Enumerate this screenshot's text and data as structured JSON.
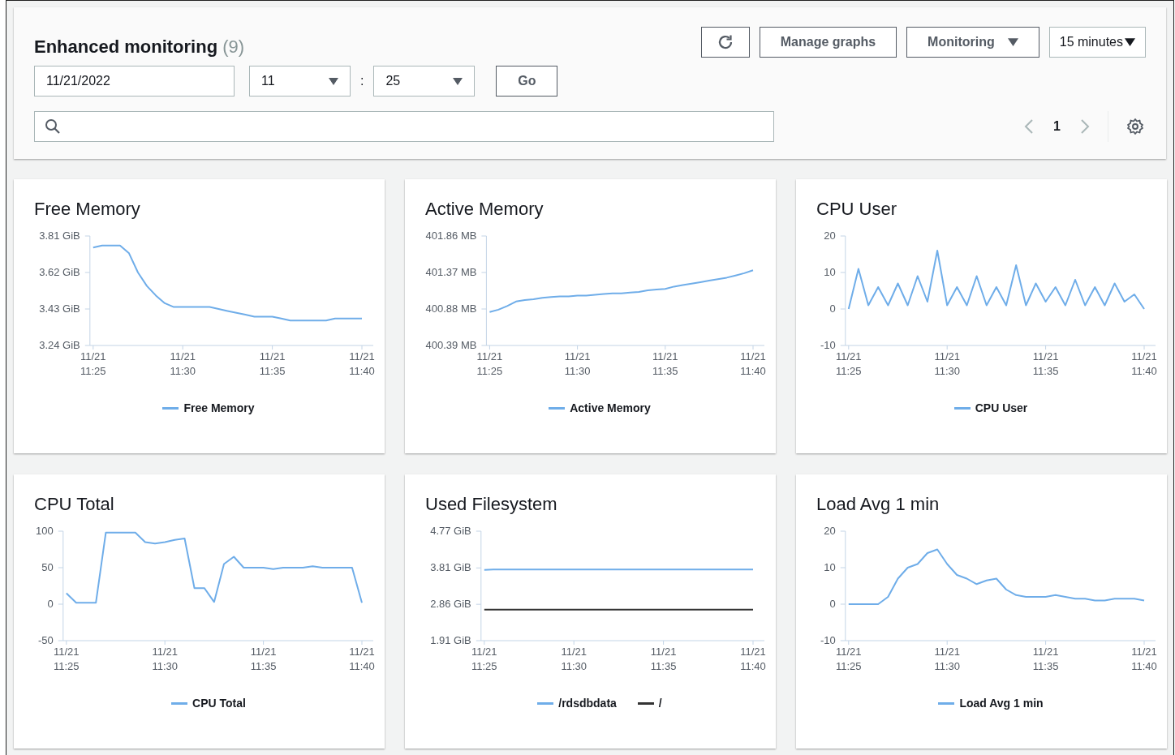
{
  "header": {
    "title": "Enhanced monitoring",
    "count": "(9)",
    "date": "11/21/2022",
    "hour": "11",
    "separator": ":",
    "minute": "25",
    "go_button": "Go",
    "manage_button": "Manage graphs",
    "monitoring_button": "Monitoring",
    "period": "15 minutes",
    "page": "1"
  },
  "graphs": [
    {
      "title": "Free Memory",
      "chart_data": {
        "type": "line",
        "legend": "bottom",
        "ylim": [
          3.24,
          3.81
        ],
        "yticks": [
          {
            "value": 3.24,
            "label": "3.24 GiB"
          },
          {
            "value": 3.43,
            "label": "3.43 GiB"
          },
          {
            "value": 3.62,
            "label": "3.62 GiB"
          },
          {
            "value": 3.81,
            "label": "3.81 GiB"
          }
        ],
        "categories": [
          "11/21 11:25",
          null,
          null,
          null,
          null,
          null,
          null,
          null,
          null,
          null,
          "11/21 11:30",
          null,
          null,
          null,
          null,
          null,
          null,
          null,
          null,
          null,
          "11/21 11:35",
          null,
          null,
          null,
          null,
          null,
          null,
          null,
          null,
          null,
          "11/21 11:40"
        ],
        "series": [
          {
            "name": "Free Memory",
            "color": "#6fade9",
            "values": [
              3.75,
              3.76,
              3.76,
              3.76,
              3.72,
              3.62,
              3.55,
              3.5,
              3.46,
              3.44,
              3.44,
              3.44,
              3.44,
              3.44,
              3.43,
              3.42,
              3.41,
              3.4,
              3.39,
              3.39,
              3.39,
              3.38,
              3.37,
              3.37,
              3.37,
              3.37,
              3.37,
              3.38,
              3.38,
              3.38,
              3.38
            ]
          }
        ]
      }
    },
    {
      "title": "Active Memory",
      "chart_data": {
        "type": "line",
        "legend": "bottom",
        "ylim": [
          400.39,
          401.86
        ],
        "yticks": [
          {
            "value": 400.39,
            "label": "400.39 MB"
          },
          {
            "value": 400.88,
            "label": "400.88 MB"
          },
          {
            "value": 401.37,
            "label": "401.37 MB"
          },
          {
            "value": 401.86,
            "label": "401.86 MB"
          }
        ],
        "categories": [
          "11/21 11:25",
          null,
          null,
          null,
          null,
          null,
          null,
          null,
          null,
          null,
          "11/21 11:30",
          null,
          null,
          null,
          null,
          null,
          null,
          null,
          null,
          null,
          "11/21 11:35",
          null,
          null,
          null,
          null,
          null,
          null,
          null,
          null,
          null,
          "11/21 11:40"
        ],
        "series": [
          {
            "name": "Active Memory",
            "color": "#6fade9",
            "values": [
              400.84,
              400.87,
              400.92,
              400.98,
              401.0,
              401.01,
              401.03,
              401.04,
              401.05,
              401.05,
              401.06,
              401.06,
              401.07,
              401.08,
              401.09,
              401.09,
              401.1,
              401.11,
              401.13,
              401.14,
              401.15,
              401.18,
              401.2,
              401.22,
              401.24,
              401.26,
              401.28,
              401.3,
              401.33,
              401.36,
              401.4
            ]
          }
        ]
      }
    },
    {
      "title": "CPU User",
      "chart_data": {
        "type": "line",
        "legend": "bottom",
        "ylim": [
          -10,
          20
        ],
        "yticks": [
          {
            "value": -10,
            "label": "-10"
          },
          {
            "value": 0,
            "label": "0"
          },
          {
            "value": 10,
            "label": "10"
          },
          {
            "value": 20,
            "label": "20"
          }
        ],
        "categories": [
          "11/21 11:25",
          null,
          null,
          null,
          null,
          null,
          null,
          null,
          null,
          null,
          "11/21 11:30",
          null,
          null,
          null,
          null,
          null,
          null,
          null,
          null,
          null,
          "11/21 11:35",
          null,
          null,
          null,
          null,
          null,
          null,
          null,
          null,
          null,
          "11/21 11:40"
        ],
        "series": [
          {
            "name": "CPU User",
            "color": "#6fade9",
            "values": [
              0,
              11,
              1,
              6,
              1,
              7,
              1,
              9,
              2,
              16,
              1,
              6,
              1,
              9,
              1,
              6,
              1,
              12,
              1,
              7,
              2,
              6,
              1,
              8,
              1,
              6,
              1,
              7,
              2,
              4,
              0
            ]
          }
        ]
      }
    },
    {
      "title": "CPU Total",
      "chart_data": {
        "type": "line",
        "legend": "bottom",
        "ylim": [
          -50,
          100
        ],
        "yticks": [
          {
            "value": -50,
            "label": "-50"
          },
          {
            "value": 0,
            "label": "0"
          },
          {
            "value": 50,
            "label": "50"
          },
          {
            "value": 100,
            "label": "100"
          }
        ],
        "categories": [
          "11/21 11:25",
          null,
          null,
          null,
          null,
          null,
          null,
          null,
          null,
          null,
          "11/21 11:30",
          null,
          null,
          null,
          null,
          null,
          null,
          null,
          null,
          null,
          "11/21 11:35",
          null,
          null,
          null,
          null,
          null,
          null,
          null,
          null,
          null,
          "11/21 11:40"
        ],
        "series": [
          {
            "name": "CPU Total",
            "color": "#6fade9",
            "values": [
              15,
              2,
              2,
              2,
              98,
              98,
              98,
              98,
              85,
              83,
              85,
              88,
              90,
              22,
              22,
              3,
              55,
              65,
              50,
              50,
              50,
              48,
              50,
              50,
              50,
              52,
              50,
              50,
              50,
              50,
              2
            ]
          }
        ]
      }
    },
    {
      "title": "Used Filesystem",
      "chart_data": {
        "type": "line",
        "legend": "bottom",
        "ylim": [
          1.91,
          4.77
        ],
        "yticks": [
          {
            "value": 1.91,
            "label": "1.91 GiB"
          },
          {
            "value": 2.86,
            "label": "2.86 GiB"
          },
          {
            "value": 3.81,
            "label": "3.81 GiB"
          },
          {
            "value": 4.77,
            "label": "4.77 GiB"
          }
        ],
        "categories": [
          "11/21 11:25",
          null,
          null,
          null,
          null,
          null,
          null,
          null,
          null,
          null,
          "11/21 11:30",
          null,
          null,
          null,
          null,
          null,
          null,
          null,
          null,
          null,
          "11/21 11:35",
          null,
          null,
          null,
          null,
          null,
          null,
          null,
          null,
          null,
          "11/21 11:40"
        ],
        "series": [
          {
            "name": "/rdsdbdata",
            "color": "#6fade9",
            "values": [
              3.76,
              3.77,
              3.77,
              3.77,
              3.77,
              3.77,
              3.77,
              3.77,
              3.77,
              3.77,
              3.77,
              3.77,
              3.77,
              3.77,
              3.77,
              3.77,
              3.77,
              3.77,
              3.77,
              3.77,
              3.77,
              3.77,
              3.77,
              3.77,
              3.77,
              3.77,
              3.77,
              3.77,
              3.77,
              3.77,
              3.77
            ]
          },
          {
            "name": "/",
            "color": "#333333",
            "values": [
              2.72,
              2.72,
              2.72,
              2.72,
              2.72,
              2.72,
              2.72,
              2.72,
              2.72,
              2.72,
              2.72,
              2.72,
              2.72,
              2.72,
              2.72,
              2.72,
              2.72,
              2.72,
              2.72,
              2.72,
              2.72,
              2.72,
              2.72,
              2.72,
              2.72,
              2.72,
              2.72,
              2.72,
              2.72,
              2.72,
              2.72
            ]
          }
        ]
      }
    },
    {
      "title": "Load Avg 1 min",
      "chart_data": {
        "type": "line",
        "legend": "bottom",
        "ylim": [
          -10,
          20
        ],
        "yticks": [
          {
            "value": -10,
            "label": "-10"
          },
          {
            "value": 0,
            "label": "0"
          },
          {
            "value": 10,
            "label": "10"
          },
          {
            "value": 20,
            "label": "20"
          }
        ],
        "categories": [
          "11/21 11:25",
          null,
          null,
          null,
          null,
          null,
          null,
          null,
          null,
          null,
          "11/21 11:30",
          null,
          null,
          null,
          null,
          null,
          null,
          null,
          null,
          null,
          "11/21 11:35",
          null,
          null,
          null,
          null,
          null,
          null,
          null,
          null,
          null,
          "11/21 11:40"
        ],
        "series": [
          {
            "name": "Load Avg 1 min",
            "color": "#6fade9",
            "values": [
              0,
              0,
              0,
              0,
              2,
              7,
              10,
              11,
              14,
              15,
              11,
              8,
              7,
              5.5,
              6.5,
              7,
              4,
              2.5,
              2,
              2,
              2,
              2.5,
              2,
              1.5,
              1.5,
              1,
              1,
              1.5,
              1.5,
              1.5,
              1
            ]
          }
        ]
      }
    }
  ]
}
